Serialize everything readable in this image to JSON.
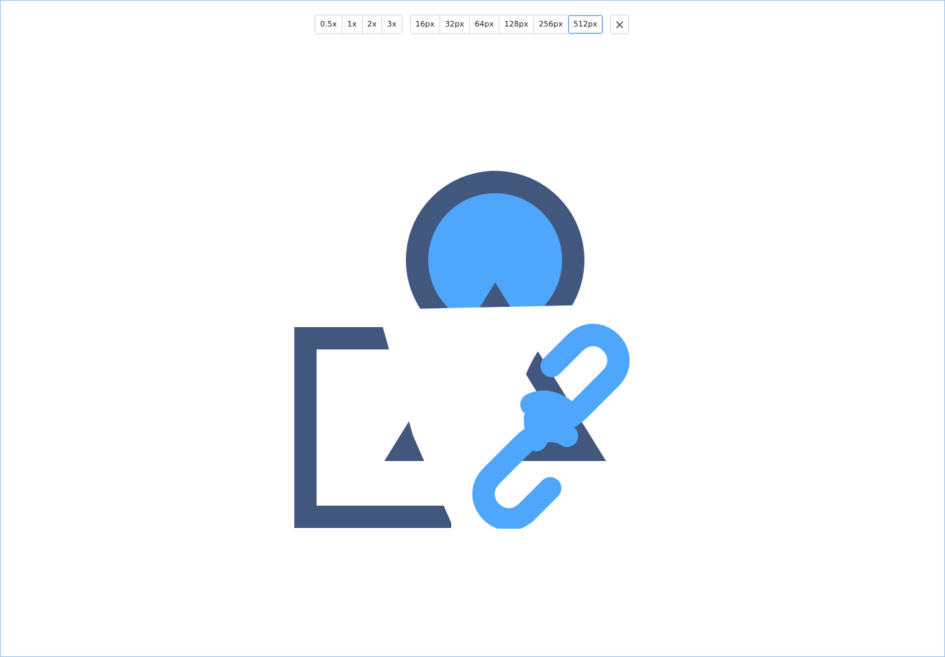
{
  "toolbar": {
    "scale_options": [
      "0.5x",
      "1x",
      "2x",
      "3x"
    ],
    "size_options": [
      "16px",
      "32px",
      "64px",
      "128px",
      "256px",
      "512px"
    ],
    "selected_size": "512px",
    "close_icon": "close-icon"
  },
  "preview": {
    "icon": "shapes-link-icon",
    "colors": {
      "dark": "#41577e",
      "light": "#4ea6fd",
      "accent_border": "#5aa2e8"
    }
  }
}
